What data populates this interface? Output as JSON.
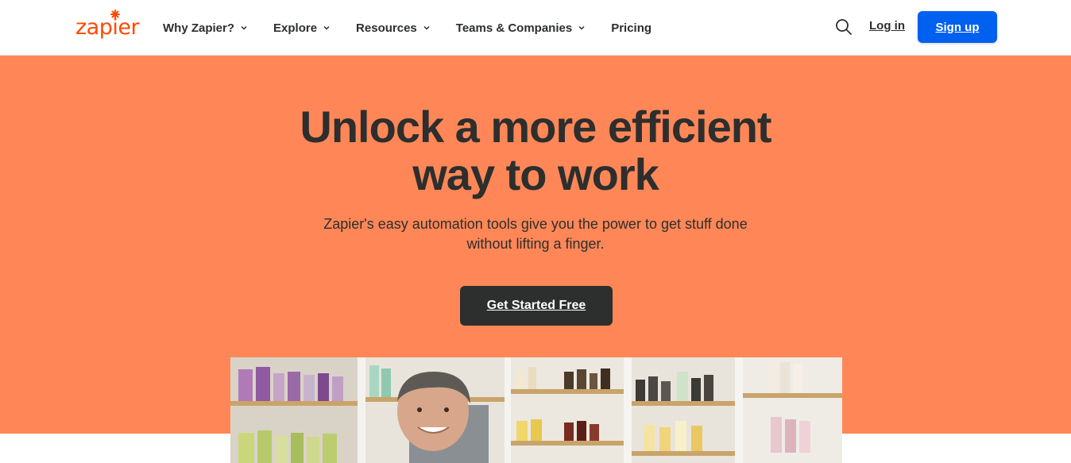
{
  "brand": {
    "name": "zapier",
    "color": "#ff4a00"
  },
  "nav": {
    "items": [
      {
        "label": "Why Zapier?",
        "has_dropdown": true
      },
      {
        "label": "Explore",
        "has_dropdown": true
      },
      {
        "label": "Resources",
        "has_dropdown": true
      },
      {
        "label": "Teams & Companies",
        "has_dropdown": true
      },
      {
        "label": "Pricing",
        "has_dropdown": false
      }
    ],
    "search_icon": "search-icon",
    "login_label": "Log in",
    "signup_label": "Sign up"
  },
  "hero": {
    "title_line1": "Unlock a more efficient",
    "title_line2": "way to work",
    "subtitle_line1": "Zapier's easy automation tools give you the power to get stuff done",
    "subtitle_line2": "without lifting a finger.",
    "cta_label": "Get Started Free"
  },
  "colors": {
    "hero_bg": "#ff8757",
    "signup_bg": "#0060f0",
    "cta_bg": "#2d2e2e",
    "text": "#2d2e2e"
  }
}
